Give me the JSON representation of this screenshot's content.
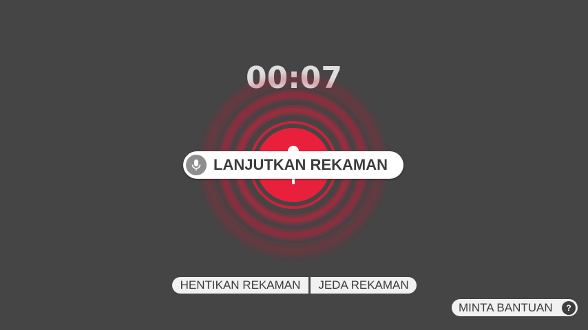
{
  "timer": {
    "elapsed": "00:07"
  },
  "status": {
    "label": "LANJUTKAN REKAMAN"
  },
  "controls": {
    "stop_label": "HENTIKAN REKAMAN",
    "pause_label": "JEDA REKAMAN"
  },
  "help": {
    "label": "MINTA BANTUAN",
    "icon_glyph": "?"
  },
  "icons": {
    "status": "microphone-icon",
    "record": "microphone-icon",
    "help": "question-mark-icon"
  },
  "colors": {
    "background": "#454545",
    "record_accent": "#e8203c",
    "pill_background": "#ffffff",
    "text_dark": "#3c3c3c"
  }
}
